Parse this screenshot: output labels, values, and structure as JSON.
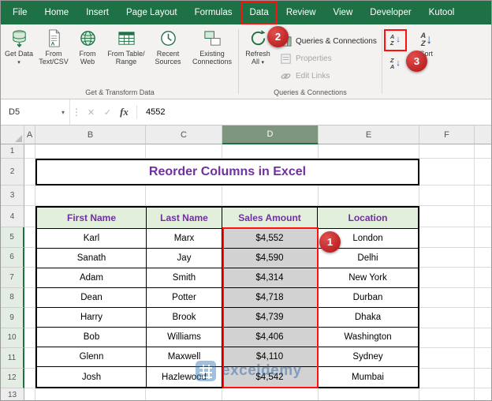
{
  "ribbon_tabs": [
    "File",
    "Home",
    "Insert",
    "Page Layout",
    "Formulas",
    "Data",
    "Review",
    "View",
    "Developer",
    "Kutool"
  ],
  "active_tab": "Data",
  "ribbon": {
    "groups": {
      "get_transform": {
        "label": "Get & Transform Data",
        "get_data": "Get Data",
        "from_text_csv": "From Text/CSV",
        "from_web": "From Web",
        "from_table_range": "From Table/ Range",
        "recent_sources": "Recent Sources",
        "existing_connections": "Existing Connections"
      },
      "queries_connections": {
        "label": "Queries & Connections",
        "refresh_all": "Refresh All",
        "queries_connections": "Queries & Connections",
        "properties": "Properties",
        "edit_links": "Edit Links"
      },
      "sort_filter": {
        "sort": "Sort"
      }
    }
  },
  "formula_bar": {
    "name_box": "D5",
    "cancel": "✕",
    "enter": "✓",
    "fx": "fx",
    "value": "4552"
  },
  "icons": {
    "caret": "▾",
    "ellipsis": "⋮",
    "down_arrow": "↓",
    "sort_a": "A",
    "sort_z": "Z"
  },
  "sheet": {
    "column_letters": [
      "",
      "A",
      "B",
      "C",
      "D",
      "E",
      "F",
      ""
    ],
    "selected_column": "D",
    "selected_rows": [
      5,
      6,
      7,
      8,
      9,
      10,
      11,
      12
    ],
    "row_count": 13,
    "title": "Reorder Columns in Excel",
    "table": {
      "headers": [
        "First Name",
        "Last Name",
        "Sales Amount",
        "Location"
      ],
      "rows": [
        [
          "Karl",
          "Marx",
          "$4,552",
          "London"
        ],
        [
          "Sanath",
          "Jay",
          "$4,590",
          "Delhi"
        ],
        [
          "Adam",
          "Smith",
          "$4,314",
          "New York"
        ],
        [
          "Dean",
          "Potter",
          "$4,718",
          "Durban"
        ],
        [
          "Harry",
          "Brook",
          "$4,739",
          "Dhaka"
        ],
        [
          "Bob",
          "Williams",
          "$4,406",
          "Washington"
        ],
        [
          "Glenn",
          "Maxwell",
          "$4,110",
          "Sydney"
        ],
        [
          "Josh",
          "Hazlewood",
          "$4,542",
          "Mumbai"
        ]
      ]
    },
    "watermark": "exceldemy"
  },
  "annotations": {
    "one": "1",
    "two": "2",
    "three": "3"
  },
  "colors": {
    "excel_green": "#1E7145",
    "annotation_red": "#FF1010",
    "circle_red": "#B01212",
    "header_purple": "#7030A0",
    "header_bg_green": "#E2EFDA",
    "selection_gray": "#D2D2D2",
    "watermark_blue": "#1F5FA8"
  }
}
